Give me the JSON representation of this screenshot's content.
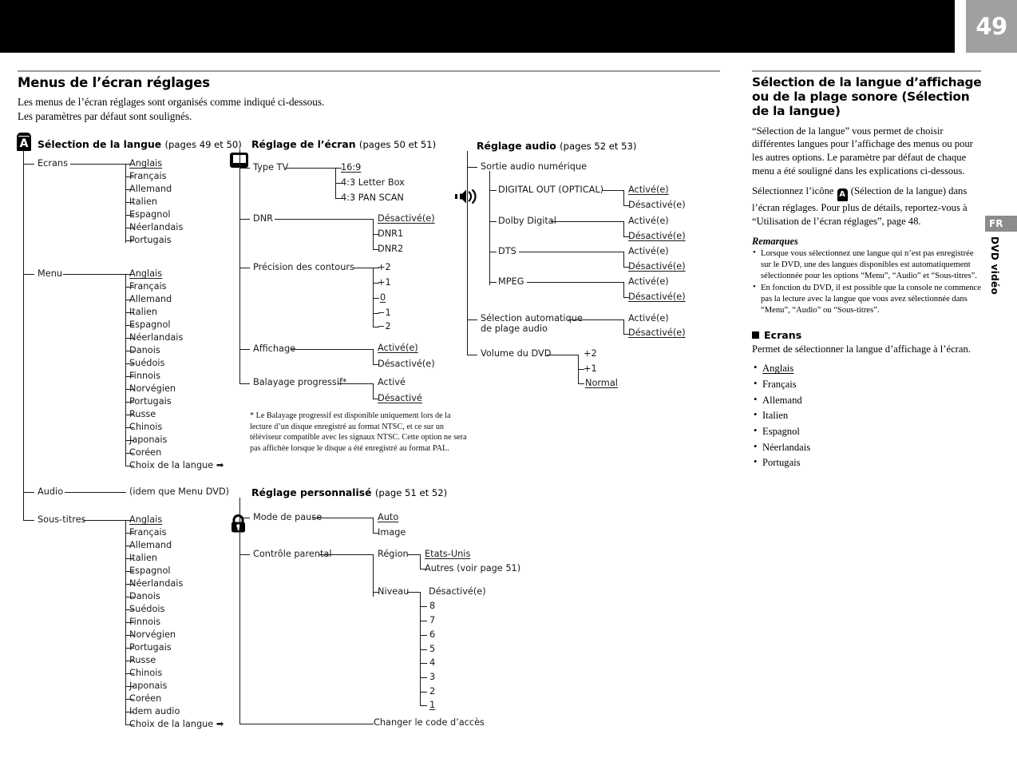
{
  "page": {
    "number": "49"
  },
  "side_tabs": {
    "lang": "FR",
    "media": "DVD vidéo"
  },
  "header": {
    "title": "Menus de l’écran réglages",
    "intro_line1": "Les menus de l’écran réglages sont organisés comme indiqué ci-dessous.",
    "intro_line2": "Les paramètres par défaut sont soulignés."
  },
  "sections": {
    "language": {
      "icon": "a-box-icon",
      "title": "Sélection de la langue",
      "pages": "(pages 49 et 50)",
      "branches": [
        {
          "label": "Ecrans",
          "options": [
            "Anglais",
            "Français",
            "Allemand",
            "Italien",
            "Espagnol",
            "Néerlandais",
            "Portugais"
          ],
          "default": "Anglais"
        },
        {
          "label": "Menu",
          "options": [
            "Anglais",
            "Français",
            "Allemand",
            "Italien",
            "Espagnol",
            "Néerlandais",
            "Danois",
            "Suédois",
            "Finnois",
            "Norvégien",
            "Portugais",
            "Russe",
            "Chinois",
            "Japonais",
            "Coréen",
            "Choix de la langue ➡"
          ],
          "default": "Anglais"
        },
        {
          "label": "Audio",
          "options": [
            "(idem que Menu DVD)"
          ],
          "default": ""
        },
        {
          "label": "Sous-titres",
          "options": [
            "Anglais",
            "Français",
            "Allemand",
            "Italien",
            "Espagnol",
            "Néerlandais",
            "Danois",
            "Suédois",
            "Finnois",
            "Norvégien",
            "Portugais",
            "Russe",
            "Chinois",
            "Japonais",
            "Coréen",
            "Idem audio",
            "Choix de la langue ➡"
          ],
          "default": "Anglais"
        }
      ]
    },
    "screen": {
      "icon": "tv-icon",
      "title": "Réglage de l’écran",
      "pages": "(pages 50 et 51)",
      "branches": [
        {
          "label": "Type TV",
          "options": [
            "16:9",
            "4:3 Letter Box",
            "4:3 PAN SCAN"
          ],
          "default": "16:9"
        },
        {
          "label": "DNR",
          "options": [
            "Désactivé(e)",
            "DNR1",
            "DNR2"
          ],
          "default": "Désactivé(e)"
        },
        {
          "label": "Précision des contours",
          "options": [
            "+2",
            "+1",
            "0",
            "−1",
            "−2"
          ],
          "default": "0"
        },
        {
          "label": "Affichage",
          "options": [
            "Activé(e)",
            "Désactivé(e)"
          ],
          "default": "Activé(e)"
        },
        {
          "label": "Balayage progressif*",
          "options": [
            "Activé",
            "Désactivé"
          ],
          "default": "Désactivé"
        }
      ],
      "footnote": "* Le Balayage progressif est disponible uniquement lors de la lecture d’un disque enregistré au format NTSC, et ce sur un téléviseur compatible avec les signaux NTSC. Cette option ne sera pas affichée lorsque le disque a été enregistré au format PAL."
    },
    "custom": {
      "icon": "lock-icon",
      "title": "Réglage personnalisé",
      "pages": "(page 51 et 52)",
      "branches": [
        {
          "label": "Mode de pause",
          "options": [
            "Auto",
            "Image"
          ],
          "default": "Auto"
        },
        {
          "label": "Contrôle parental",
          "sub": [
            {
              "label": "Région",
              "options": [
                "Etats-Unis",
                "Autres (voir page 51)"
              ],
              "default": "Etats-Unis"
            },
            {
              "label": "Niveau",
              "options": [
                "Désactivé(e)",
                "8",
                "7",
                "6",
                "5",
                "4",
                "3",
                "2",
                "1"
              ],
              "default": "1"
            }
          ]
        },
        {
          "label": "Changer le code d’accès",
          "options": [],
          "default": ""
        }
      ]
    },
    "audio": {
      "icon": "speaker-icon",
      "title": "Réglage audio",
      "pages": "(pages 52 et 53)",
      "branches": [
        {
          "label": "Sortie audio numérique",
          "sub": [
            {
              "label": "DIGITAL OUT (OPTICAL)",
              "options": [
                "Activé(e)",
                "Désactivé(e)"
              ],
              "default": "Activé(e)"
            },
            {
              "label": "Dolby Digital",
              "options": [
                "Activé(e)",
                "Désactivé(e)"
              ],
              "default": "Désactivé(e)"
            },
            {
              "label": "DTS",
              "options": [
                "Activé(e)",
                "Désactivé(e)"
              ],
              "default": "Désactivé(e)"
            },
            {
              "label": "MPEG",
              "options": [
                "Activé(e)",
                "Désactivé(e)"
              ],
              "default": "Désactivé(e)"
            }
          ]
        },
        {
          "label": "Sélection automatique de plage audio",
          "options": [
            "Activé(e)",
            "Désactivé(e)"
          ],
          "default": "Désactivé(e)"
        },
        {
          "label": "Volume du DVD",
          "options": [
            "+2",
            "+1",
            "Normal"
          ],
          "default": "Normal"
        }
      ]
    }
  },
  "nodes": {
    "l_ecrans": "Ecrans",
    "l_menu": "Menu",
    "l_audio": "Audio",
    "l_soustitres": "Sous-titres",
    "l_idem": "(idem que Menu DVD)",
    "lang_anglais": "Anglais",
    "lang_francais": "Français",
    "lang_allemand": "Allemand",
    "lang_italien": "Italien",
    "lang_espagnol": "Espagnol",
    "lang_neerlandais": "Néerlandais",
    "lang_portugais": "Portugais",
    "lang_danois": "Danois",
    "lang_suedois": "Suédois",
    "lang_finnois": "Finnois",
    "lang_norvegien": "Norvégien",
    "lang_russe": "Russe",
    "lang_chinois": "Chinois",
    "lang_japonais": "Japonais",
    "lang_coreen": "Coréen",
    "lang_choix": "Choix de la langue ➡",
    "lang_idemaudio": "Idem audio",
    "s_typetv": "Type TV",
    "s_169": "16:9",
    "s_letterbox": "4:3 Letter Box",
    "s_panscan": "4:3 PAN SCAN",
    "s_dnr": "DNR",
    "s_desact": "Désactivé(e)",
    "s_dnr1": "DNR1",
    "s_dnr2": "DNR2",
    "s_precision": "Précision des contours",
    "s_p2": "+2",
    "s_p1": "+1",
    "s_0": "0",
    "s_m1": "−1",
    "s_m2": "−2",
    "s_affichage": "Affichage",
    "s_act": "Activé(e)",
    "s_balayage": "Balayage progressif*",
    "s_active": "Activé",
    "s_desactive": "Désactivé",
    "c_modepause": "Mode de pause",
    "c_auto": "Auto",
    "c_image": "Image",
    "c_controle": "Contrôle parental",
    "c_region": "Région",
    "c_etatsunis": "Etats-Unis",
    "c_autres": "Autres (voir page 51)",
    "c_niveau": "Niveau",
    "c_off": "Désactivé(e)",
    "c_8": "8",
    "c_7": "7",
    "c_6": "6",
    "c_5": "5",
    "c_4": "4",
    "c_3": "3",
    "c_2": "2",
    "c_1": "1",
    "c_changer": "Changer le code d’accès",
    "a_sortie": "Sortie audio numérique",
    "a_digitalout": "DIGITAL OUT (OPTICAL)",
    "a_dolby": "Dolby Digital",
    "a_dts": "DTS",
    "a_mpeg": "MPEG",
    "a_act": "Activé(e)",
    "a_desact": "Désactivé(e)",
    "a_selauto1": "Sélection automatique",
    "a_selauto2": "de plage audio",
    "a_volume": "Volume du DVD",
    "a_p2": "+2",
    "a_p1": "+1",
    "a_normal": "Normal"
  },
  "right": {
    "title": "Sélection de la langue d’affichage ou de la plage sonore (Sélection de la langue)",
    "p1": "“Sélection de la langue” vous permet de choisir différentes langues pour l’affichage des menus ou pour les autres options. Le paramètre par défaut de chaque menu a été souligné dans les explications ci-dessous.",
    "p2_before": "Sélectionnez l’icône",
    "p2_after": "(Sélection de la langue) dans l’écran réglages. Pour plus de détails, reportez-vous à “Utilisation de l’écran réglages”, page 48.",
    "remarques_title": "Remarques",
    "notes": [
      "Lorsque vous sélectionnez une langue qui n’est pas enregistrée sur le DVD, une des langues disponibles est automatiquement sélectionnée pour les options “Menu”, “Audio” et “Sous-titres”.",
      "En fonction du DVD, il est possible que la console ne commence pas la lecture avec la langue que vous avez sélectionnée dans “Menu”, “Audio” ou “Sous-titres”."
    ],
    "ecrans_title": "Ecrans",
    "ecrans_desc": "Permet de sélectionner la langue d’affichage à l’écran.",
    "ecrans_list": [
      "Anglais",
      "Français",
      "Allemand",
      "Italien",
      "Espagnol",
      "Néerlandais",
      "Portugais"
    ],
    "ecrans_default": "Anglais"
  },
  "colors": {
    "page_badge_bg": "#a0a0a0",
    "band": "#000000",
    "rule": "#9a9a9a",
    "tab_fr_bg": "#8c8c8c"
  }
}
